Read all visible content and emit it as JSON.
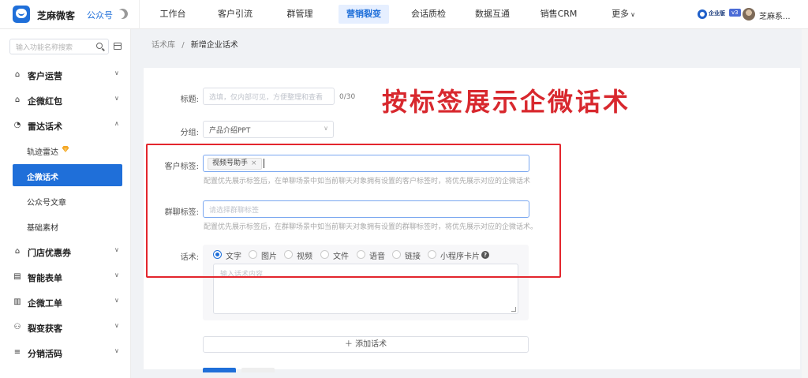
{
  "header": {
    "brand": "芝麻微客",
    "account_type": "公众号",
    "nav": [
      {
        "label": "工作台"
      },
      {
        "label": "客户引流"
      },
      {
        "label": "群管理"
      },
      {
        "label": "营销裂变",
        "active": true
      },
      {
        "label": "会话质检"
      },
      {
        "label": "数据互通"
      },
      {
        "label": "销售CRM"
      },
      {
        "label": "更多"
      }
    ],
    "edition_label": "企业版",
    "edition_version": "v3",
    "username": "芝麻系..."
  },
  "sidebar": {
    "search_placeholder": "输入功能名称搜索",
    "groups": [
      {
        "label": "客户运营",
        "icon": "home-icon"
      },
      {
        "label": "企微红包",
        "icon": "home-icon"
      },
      {
        "label": "雷达话术",
        "icon": "radar-icon",
        "expanded": true,
        "children": [
          {
            "label": "轨迹雷达"
          },
          {
            "label": "企微话术",
            "active": true
          },
          {
            "label": "公众号文章"
          },
          {
            "label": "基础素材"
          }
        ]
      },
      {
        "label": "门店优惠券",
        "icon": "home-icon"
      },
      {
        "label": "智能表单",
        "icon": "form-icon"
      },
      {
        "label": "企微工单",
        "icon": "ticket-icon"
      },
      {
        "label": "裂变获客",
        "icon": "users-icon"
      },
      {
        "label": "分销活码",
        "icon": "list-icon"
      }
    ]
  },
  "breadcrumb": {
    "root": "话术库",
    "separator": "/",
    "current": "新增企业话术"
  },
  "form": {
    "title_label": "标题:",
    "title_placeholder": "选填，仅内部可见，方便整理和查看",
    "title_counter": "0/30",
    "group_label": "分组:",
    "group_value": "产品介绍PPT",
    "customer_tag_label": "客户标签:",
    "customer_tag_value": "视频号助手",
    "customer_tag_hint": "配置优先展示标签后，在单聊场景中如当前聊天对象拥有设置的客户标签时，将优先展示对应的企微话术",
    "group_tag_label": "群聊标签:",
    "group_tag_placeholder": "请选择群聊标签",
    "group_tag_hint": "配置优先展示标签后，在群聊场景中如当前聊天对象拥有设置的群聊标签时，将优先展示对应的企微话术。",
    "script_label": "话术:",
    "script_types": [
      "文字",
      "图片",
      "视频",
      "文件",
      "语音",
      "链接",
      "小程序卡片"
    ],
    "script_selected": "文字",
    "script_placeholder": "输入话术内容",
    "add_script": "＋ 添加话术"
  },
  "annotation": {
    "text": "按标签展示企微话术",
    "color": "#d8282e"
  },
  "colors": {
    "primary": "#1f6fd9",
    "annotation_red": "#e3262d"
  }
}
